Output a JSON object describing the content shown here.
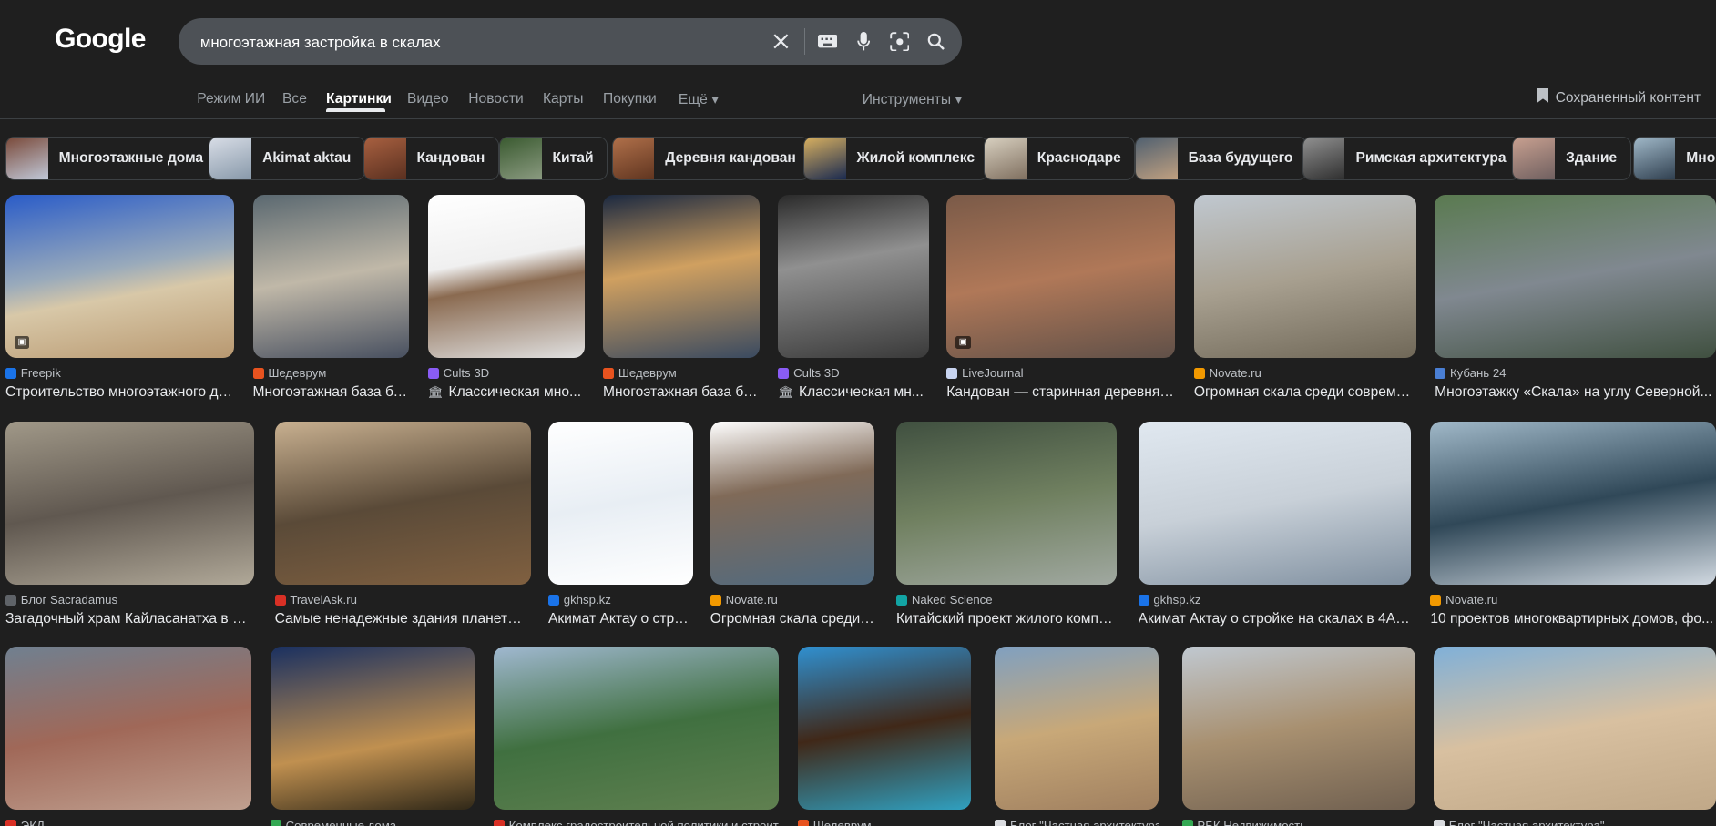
{
  "header": {
    "logo": "Google",
    "search_query": "многоэтажная застройка в скалах",
    "icons": [
      "clear-icon",
      "keyboard-icon",
      "mic-icon",
      "lens-icon",
      "search-icon"
    ]
  },
  "tabs": [
    {
      "label": "Режим ИИ",
      "active": false
    },
    {
      "label": "Все",
      "active": false
    },
    {
      "label": "Картинки",
      "active": true
    },
    {
      "label": "Видео",
      "active": false
    },
    {
      "label": "Новости",
      "active": false
    },
    {
      "label": "Карты",
      "active": false
    },
    {
      "label": "Покупки",
      "active": false
    },
    {
      "label": "Ещё ▾",
      "active": false
    }
  ],
  "tools_label": "Инструменты ▾",
  "saved_label": "Сохраненный контент",
  "chips": [
    "Многоэтажные дома",
    "Akimat aktau",
    "Кандован",
    "Китай",
    "Деревня кандован",
    "Жилой комплекс",
    "Краснодаре",
    "База будущего",
    "Римская архитектура",
    "Здание",
    "Многоэтажка"
  ],
  "rows": [
    [
      {
        "source": "Freepik",
        "title": "Строительство многоэтажного до...",
        "fav": "#1a73e8",
        "product": false
      },
      {
        "source": "Шедеврум",
        "title": "Многоэтажная база бу...",
        "fav": "#e8531f",
        "product": false
      },
      {
        "source": "Cults 3D",
        "title": "Классическая мно...",
        "fav": "#8a5cf5",
        "product": true
      },
      {
        "source": "Шедеврум",
        "title": "Многоэтажная база бу...",
        "fav": "#e8531f",
        "product": false
      },
      {
        "source": "Cults 3D",
        "title": "Классическая мн...",
        "fav": "#8a5cf5",
        "product": true
      },
      {
        "source": "LiveJournal",
        "title": "Кандован — старинная деревня в...",
        "fav": "#c8d4f0",
        "product": false
      },
      {
        "source": "Novate.ru",
        "title": "Огромная скала среди современ...",
        "fav": "#f29900",
        "product": false
      },
      {
        "source": "Кубань 24",
        "title": "Многоэтажку «Скала» на углу Северной...",
        "fav": "#4a7fd4",
        "product": false
      }
    ],
    [
      {
        "source": "Блог Sacradamus",
        "title": "Загадочный храм Кайласанатха в Ин...",
        "fav": "#5f6368",
        "product": false
      },
      {
        "source": "TravelAsk.ru",
        "title": "Самые ненадежные здания планеты: ...",
        "fav": "#d93025",
        "product": false
      },
      {
        "source": "gkhsp.kz",
        "title": "Акимат Актау о стро...",
        "fav": "#1a73e8",
        "product": false
      },
      {
        "source": "Novate.ru",
        "title": "Огромная скала среди ...",
        "fav": "#f29900",
        "product": false
      },
      {
        "source": "Naked Science",
        "title": "Китайский проект жилого компле...",
        "fav": "#12a4a4",
        "product": false
      },
      {
        "source": "gkhsp.kz",
        "title": "Акимат Актау о стройке на скалах в 4А - ...",
        "fav": "#1a73e8",
        "product": false
      },
      {
        "source": "Novate.ru",
        "title": "10 проектов многоквартирных домов, фо...",
        "fav": "#f29900",
        "product": false
      }
    ],
    [
      {
        "source": "ЭКД",
        "title": "",
        "fav": "#d93025",
        "product": false
      },
      {
        "source": "Современные дома",
        "title": "",
        "fav": "#34a853",
        "product": false
      },
      {
        "source": "Комплекс градостроительной политики и строит...",
        "title": "",
        "fav": "#d93025",
        "product": false
      },
      {
        "source": "Шедеврум",
        "title": "",
        "fav": "#e8531f",
        "product": false
      },
      {
        "source": "Блог \"Частная архитектура\"",
        "title": "",
        "fav": "#dadce0",
        "product": false
      },
      {
        "source": "РБК Недвижимость",
        "title": "",
        "fav": "#34a853",
        "product": false
      },
      {
        "source": "Блог \"Частная архитектура\"",
        "title": "",
        "fav": "#dadce0",
        "product": false
      }
    ]
  ]
}
